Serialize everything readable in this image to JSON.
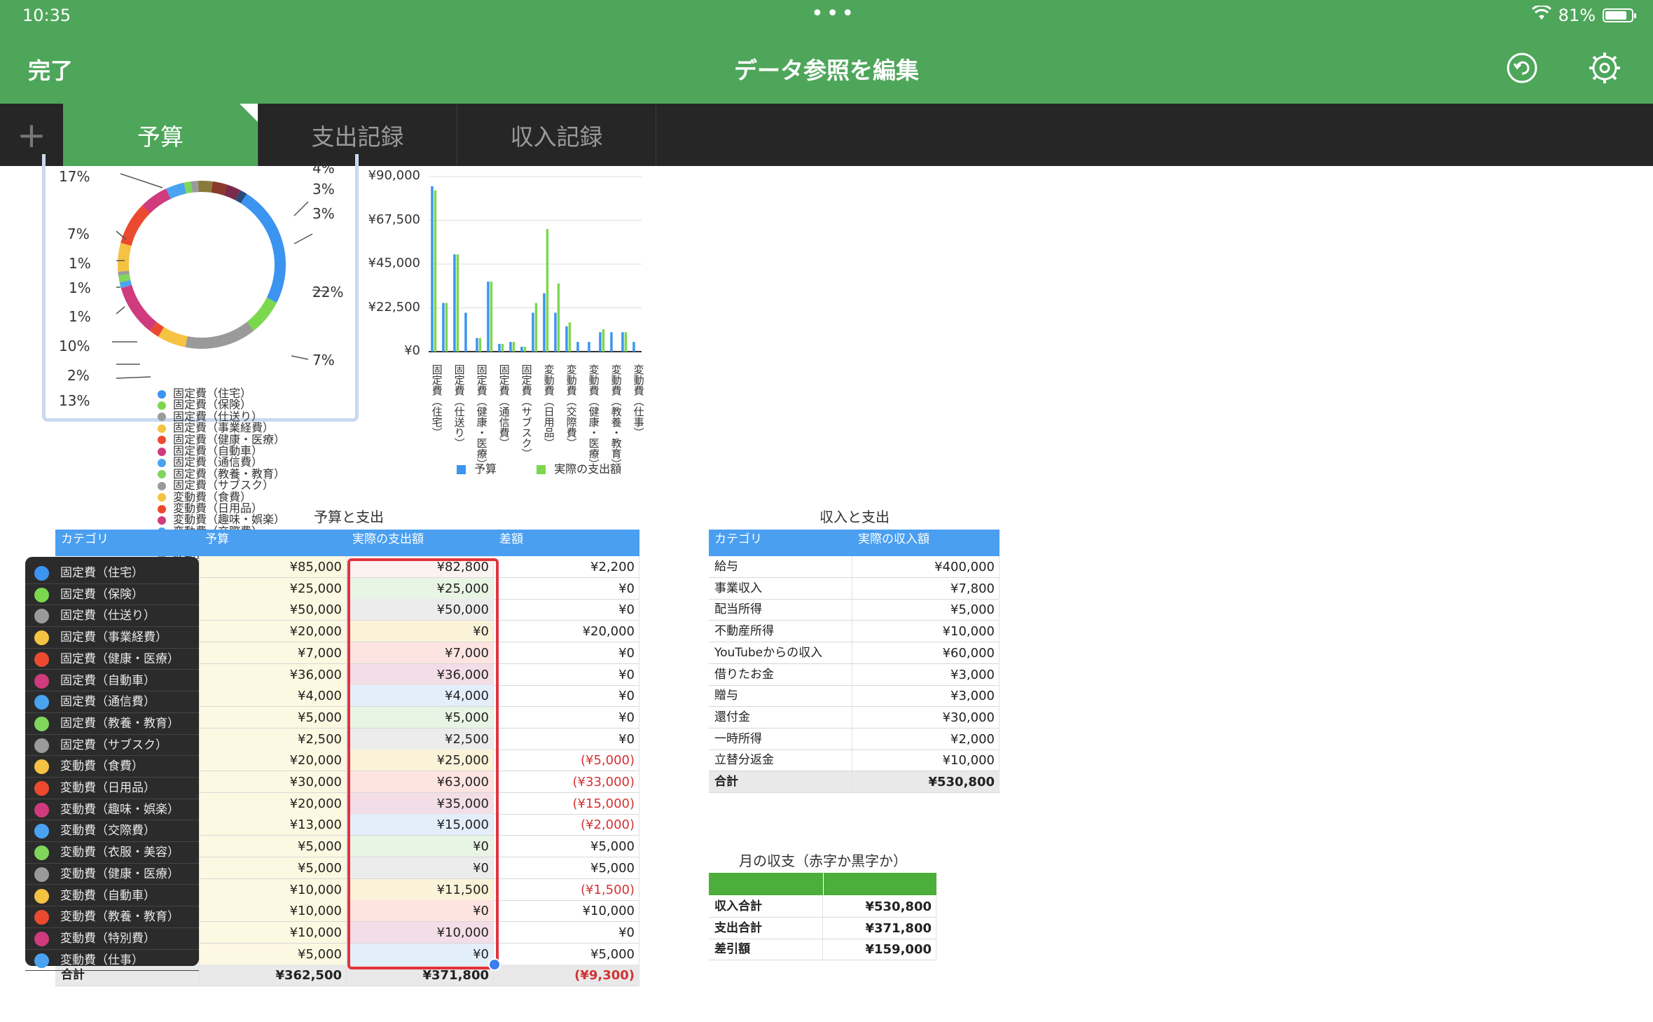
{
  "status_bar": {
    "time": "10:35",
    "dots": "•••",
    "battery_text": "81%"
  },
  "nav": {
    "done_label": "完了",
    "title": "データ参照を編集",
    "undo_icon": "undo-icon",
    "settings_icon": "gear-icon"
  },
  "tabs": {
    "add_label": "+",
    "items": [
      "予算",
      "支出記録",
      "収入記録"
    ],
    "active": 0
  },
  "pie_chart": {
    "top_partial_label": "4%",
    "labels_left": [
      "17%",
      "7%",
      "1%",
      "1%",
      "1%",
      "10%",
      "2%",
      "13%"
    ],
    "labels_right": [
      "3%",
      "3%",
      "22%",
      "7%"
    ],
    "legend": [
      {
        "label": "固定費（住宅）",
        "color": "#3b94f0"
      },
      {
        "label": "固定費（保険）",
        "color": "#7bd84e"
      },
      {
        "label": "固定費（仕送り）",
        "color": "#9a9a9a"
      },
      {
        "label": "固定費（事業経費）",
        "color": "#f5c242"
      },
      {
        "label": "固定費（健康・医療）",
        "color": "#ec4a30"
      },
      {
        "label": "固定費（自動車）",
        "color": "#cf3b7c"
      },
      {
        "label": "固定費（通信費）",
        "color": "#4aa3f0"
      },
      {
        "label": "固定費（教養・教育）",
        "color": "#7fd65a"
      },
      {
        "label": "固定費（サブスク）",
        "color": "#9a9a9a"
      },
      {
        "label": "変動費（食費）",
        "color": "#f5c242"
      },
      {
        "label": "変動費（日用品）",
        "color": "#ec4a30"
      },
      {
        "label": "変動費（趣味・娯楽）",
        "color": "#cf3b7c"
      },
      {
        "label": "変動費（交際費）",
        "color": "#4aa3f0"
      },
      {
        "label": "変動費（衣服・美容）",
        "color": "#7fd65a"
      },
      {
        "label": "変動費（健康・医療）",
        "color": "#9a9a9a"
      },
      {
        "label": "変動費（自動車）",
        "color": "#8a7a3a"
      },
      {
        "label": "変動費（教養・教育）",
        "color": "#8a3a2a"
      },
      {
        "label": "変動費（特別費）",
        "color": "#7a2a4a"
      },
      {
        "label": "変動費（仕事）",
        "color": "#2a4a7a"
      }
    ]
  },
  "chart_data": {
    "type": "bar",
    "title": "",
    "ylim": [
      0,
      90000
    ],
    "yticks": [
      "¥90,000",
      "¥67,500",
      "¥45,000",
      "¥22,500",
      "¥0"
    ],
    "categories": [
      "固定費（住宅）",
      "固定費（保険）",
      "固定費（仕送り）",
      "固定費（事業経費）",
      "固定費（健康・医療）",
      "固定費（自動車）",
      "固定費（通信費）",
      "固定費（教養・教育）",
      "固定費（サブスク）",
      "変動費（食費）",
      "変動費（日用品）",
      "変動費（趣味・娯楽）",
      "変動費（交際費）",
      "変動費（衣服・美容）",
      "変動費（健康・医療）",
      "変動費（自動車）",
      "変動費（教養・教育）",
      "変動費（特別費）",
      "変動費（仕事）"
    ],
    "x_labels_shown": [
      "固定費（住宅）",
      "固定費（仕送り）",
      "固定費（健康・医療）",
      "固定費（通信費）",
      "固定費（サブスク）",
      "変動費（日用品）",
      "変動費（交際費）",
      "変動費（健康・医療）",
      "変動費（教養・教育）",
      "変動費（仕事）"
    ],
    "series": [
      {
        "name": "予算",
        "color": "#3b94f0",
        "values": [
          85000,
          25000,
          50000,
          20000,
          7000,
          36000,
          4000,
          5000,
          2500,
          20000,
          30000,
          20000,
          13000,
          5000,
          5000,
          10000,
          10000,
          10000,
          5000
        ]
      },
      {
        "name": "実際の支出額",
        "color": "#7bd84e",
        "values": [
          82800,
          25000,
          50000,
          0,
          7000,
          36000,
          4000,
          5000,
          2500,
          25000,
          63000,
          35000,
          15000,
          0,
          0,
          11500,
          0,
          10000,
          0
        ]
      }
    ],
    "legend_position": "bottom"
  },
  "budget_table": {
    "title": "予算と支出",
    "headers": [
      "カテゴリ",
      "予算",
      "実際の支出額",
      "差額"
    ],
    "rows": [
      [
        "固定費（住宅）",
        "¥85,000",
        "¥82,800",
        "¥2,200"
      ],
      [
        "固定費（保険）",
        "¥25,000",
        "¥25,000",
        "¥0"
      ],
      [
        "固定費（仕送り）",
        "¥50,000",
        "¥50,000",
        "¥0"
      ],
      [
        "固定費（事業経費）",
        "¥20,000",
        "¥0",
        "¥20,000"
      ],
      [
        "固定費（健康・医療）",
        "¥7,000",
        "¥7,000",
        "¥0"
      ],
      [
        "固定費（自動車）",
        "¥36,000",
        "¥36,000",
        "¥0"
      ],
      [
        "固定費（通信費）",
        "¥4,000",
        "¥4,000",
        "¥0"
      ],
      [
        "固定費（教養・教育）",
        "¥5,000",
        "¥5,000",
        "¥0"
      ],
      [
        "固定費（サブスク）",
        "¥2,500",
        "¥2,500",
        "¥0"
      ],
      [
        "変動費（食費）",
        "¥20,000",
        "¥25,000",
        "(¥5,000)"
      ],
      [
        "変動費（日用品）",
        "¥30,000",
        "¥63,000",
        "(¥33,000)"
      ],
      [
        "変動費（趣味・娯楽）",
        "¥20,000",
        "¥35,000",
        "(¥15,000)"
      ],
      [
        "変動費（交際費）",
        "¥13,000",
        "¥15,000",
        "(¥2,000)"
      ],
      [
        "変動費（衣服・美容）",
        "¥5,000",
        "¥0",
        "¥5,000"
      ],
      [
        "変動費（健康・医療）",
        "¥5,000",
        "¥0",
        "¥5,000"
      ],
      [
        "変動費（自動車）",
        "¥10,000",
        "¥11,500",
        "(¥1,500)"
      ],
      [
        "変動費（教養・教育）",
        "¥10,000",
        "¥0",
        "¥10,000"
      ],
      [
        "変動費（特別費）",
        "¥10,000",
        "¥10,000",
        "¥0"
      ],
      [
        "変動費（仕事）",
        "¥5,000",
        "¥0",
        "¥5,000"
      ]
    ],
    "total": [
      "合計",
      "¥362,500",
      "¥371,800",
      "(¥9,300)"
    ]
  },
  "income_table": {
    "title": "収入と支出",
    "headers": [
      "カテゴリ",
      "実際の収入額"
    ],
    "rows": [
      [
        "給与",
        "¥400,000"
      ],
      [
        "事業収入",
        "¥7,800"
      ],
      [
        "配当所得",
        "¥5,000"
      ],
      [
        "不動産所得",
        "¥10,000"
      ],
      [
        "YouTubeからの収入",
        "¥60,000"
      ],
      [
        "借りたお金",
        "¥3,000"
      ],
      [
        "贈与",
        "¥3,000"
      ],
      [
        "還付金",
        "¥30,000"
      ],
      [
        "一時所得",
        "¥2,000"
      ],
      [
        "立替分返金",
        "¥10,000"
      ]
    ],
    "total": [
      "合計",
      "¥530,800"
    ]
  },
  "balance_table": {
    "title": "月の収支（赤字か黒字か）",
    "rows": [
      [
        "収入合計",
        "¥530,800"
      ],
      [
        "支出合計",
        "¥371,800"
      ],
      [
        "差引額",
        "¥159,000"
      ]
    ]
  },
  "color_panel": {
    "items": [
      {
        "label": "固定費（住宅）",
        "color": "#3b94f0"
      },
      {
        "label": "固定費（保険）",
        "color": "#7bd84e"
      },
      {
        "label": "固定費（仕送り）",
        "color": "#9a9a9a"
      },
      {
        "label": "固定費（事業経費）",
        "color": "#f5c242"
      },
      {
        "label": "固定費（健康・医療）",
        "color": "#ec4a30"
      },
      {
        "label": "固定費（自動車）",
        "color": "#cf3b7c"
      },
      {
        "label": "固定費（通信費）",
        "color": "#4aa3f0"
      },
      {
        "label": "固定費（教養・教育）",
        "color": "#7fd65a"
      },
      {
        "label": "固定費（サブスク）",
        "color": "#9a9a9a"
      },
      {
        "label": "変動費（食費）",
        "color": "#f5c242"
      },
      {
        "label": "変動費（日用品）",
        "color": "#ec4a30"
      },
      {
        "label": "変動費（趣味・娯楽）",
        "color": "#cf3b7c"
      },
      {
        "label": "変動費（交際費）",
        "color": "#4aa3f0"
      },
      {
        "label": "変動費（衣服・美容）",
        "color": "#7fd65a"
      },
      {
        "label": "変動費（健康・医療）",
        "color": "#9a9a9a"
      },
      {
        "label": "変動費（自動車）",
        "color": "#f5c242"
      },
      {
        "label": "変動費（教養・教育）",
        "color": "#ec4a30"
      },
      {
        "label": "変動費（特別費）",
        "color": "#cf3b7c"
      },
      {
        "label": "変動費（仕事）",
        "color": "#4aa3f0"
      }
    ]
  },
  "colors": {
    "header_green": "#4ea65a",
    "tab_bar": "#262626",
    "table_header_blue": "#4a9ff0",
    "balance_header_green": "#4caf3c",
    "negative_red": "#d23232",
    "selection_red": "#e0343e",
    "budget_col_bg": "#fdf8e1",
    "actual_col_tints": [
      "#fdf2f2",
      "#e8f4e4",
      "#ececec",
      "#fbf3d9",
      "#fde4e1",
      "#f3dde6",
      "#e3eefb",
      "#e8f4e4",
      "#ececec",
      "#fbf3d9",
      "#fde4e1",
      "#f3dde6",
      "#e3eefb",
      "#e8f4e4",
      "#ececec",
      "#fbf3d9",
      "#fde4e1",
      "#f3dde6",
      "#e3eefb"
    ]
  }
}
